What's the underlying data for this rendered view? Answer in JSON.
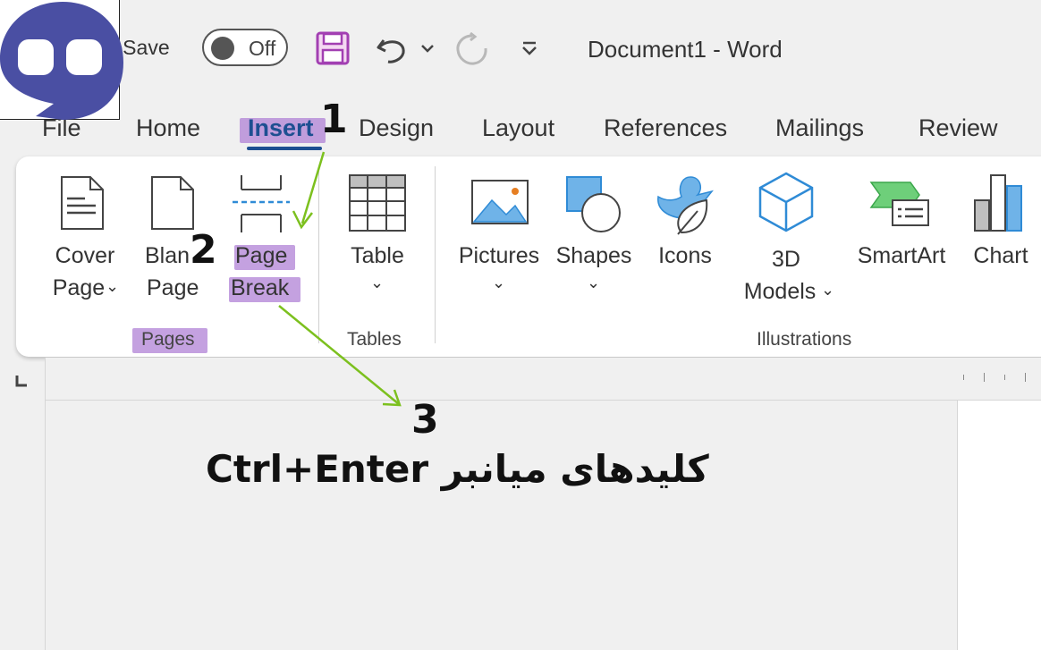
{
  "title_bar": {
    "autosave_label": "toSave",
    "toggle_state": "Off",
    "document_title": "Document1  -  Word"
  },
  "tabs": [
    {
      "label": "File"
    },
    {
      "label": "Home"
    },
    {
      "label": "Insert"
    },
    {
      "label": "Design"
    },
    {
      "label": "Layout"
    },
    {
      "label": "References"
    },
    {
      "label": "Mailings"
    },
    {
      "label": "Review"
    }
  ],
  "ribbon": {
    "cover_page": {
      "line1": "Cover",
      "line2": "Page"
    },
    "blank_page": {
      "line1": "Blan",
      "line2": "Page"
    },
    "page_break": {
      "line1": "Page",
      "line2": "Break"
    },
    "table": {
      "label": "Table"
    },
    "pictures": {
      "label": "Pictures"
    },
    "shapes": {
      "label": "Shapes"
    },
    "icons": {
      "label": "Icons"
    },
    "models_3d": {
      "line1": "3D",
      "line2": "Models"
    },
    "smartart": {
      "label": "SmartArt"
    },
    "chart": {
      "label": "Chart"
    },
    "groups": {
      "pages": "Pages",
      "tables": "Tables",
      "illustrations": "Illustrations"
    }
  },
  "annotations": {
    "step1": "1",
    "step2": "2",
    "step3": "3",
    "caption": "Ctrl+Enter کلیدهای میانبر"
  },
  "colors": {
    "highlight": "#b082d6",
    "active_tab": "#1d4f91",
    "arrow": "#7cc01e",
    "logo": "#4a4fa3",
    "save_icon": "#a23fb2",
    "accent_blue": "#2f8bd6"
  },
  "icons": {
    "save": "save-icon",
    "undo": "undo-icon",
    "redo": "redo-icon",
    "customize": "customize-qat-icon"
  }
}
